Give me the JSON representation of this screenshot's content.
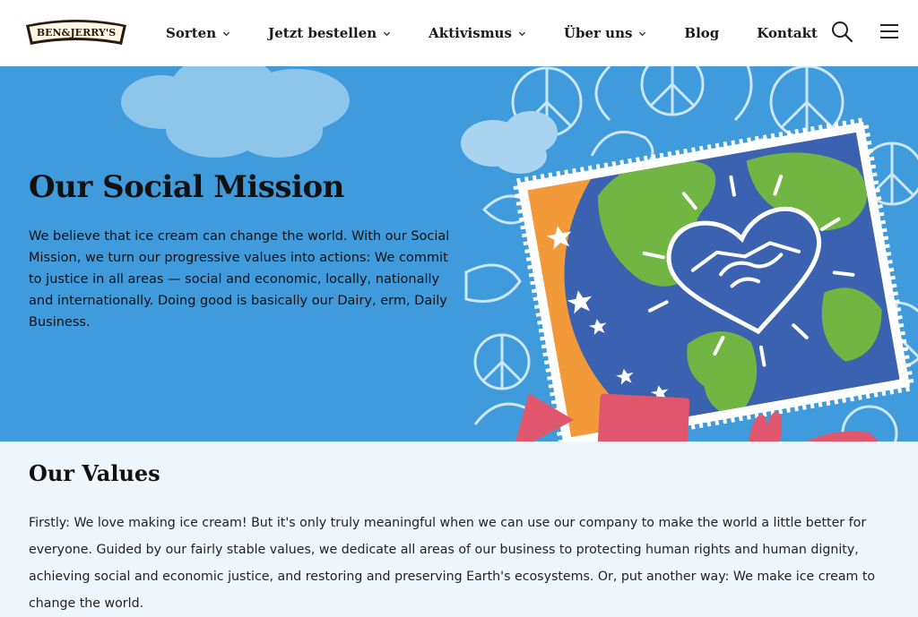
{
  "brand": {
    "logo_text": "BEN&JERRY'S"
  },
  "nav": {
    "items": [
      {
        "label": "Sorten",
        "has_dropdown": true
      },
      {
        "label": "Jetzt bestellen",
        "has_dropdown": true
      },
      {
        "label": "Aktivismus",
        "has_dropdown": true
      },
      {
        "label": "Über uns",
        "has_dropdown": true
      },
      {
        "label": "Blog",
        "has_dropdown": false
      },
      {
        "label": "Kontakt",
        "has_dropdown": false
      }
    ],
    "search_icon": "search-icon",
    "menu_icon": "hamburger-menu-icon"
  },
  "hero": {
    "title": "Our Social Mission",
    "body": "We believe that ice cream can change the world. With our Social Mission, we turn our progressive values into actions: We commit to justice in all areas — social and economic, locally, nationally and internationally. Doing good is basically our Dairy, erm, Daily Business.",
    "background_color": "#3f9bdc",
    "illustration": "globe-handshake-heart-stamp"
  },
  "values": {
    "title": "Our Values",
    "body": "Firstly: We love making ice cream! But it's only truly meaningful when we can use our company to make the world a little better for everyone. Guided by our fairly stable values, we dedicate all areas of our business to protecting human rights and human dignity, achieving social and economic justice, and restoring and preserving Earth's ecosystems. Or, put another way: We make ice cream to change the world."
  },
  "colors": {
    "header_bg": "#ffffff",
    "hero_bg": "#3f9bdc",
    "values_bg": "#eef5fb",
    "text": "#111111",
    "stamp_orange": "#f29a3a",
    "globe_blue": "#3b62b0",
    "land_green": "#71b643",
    "accent_red": "#e0566d"
  }
}
